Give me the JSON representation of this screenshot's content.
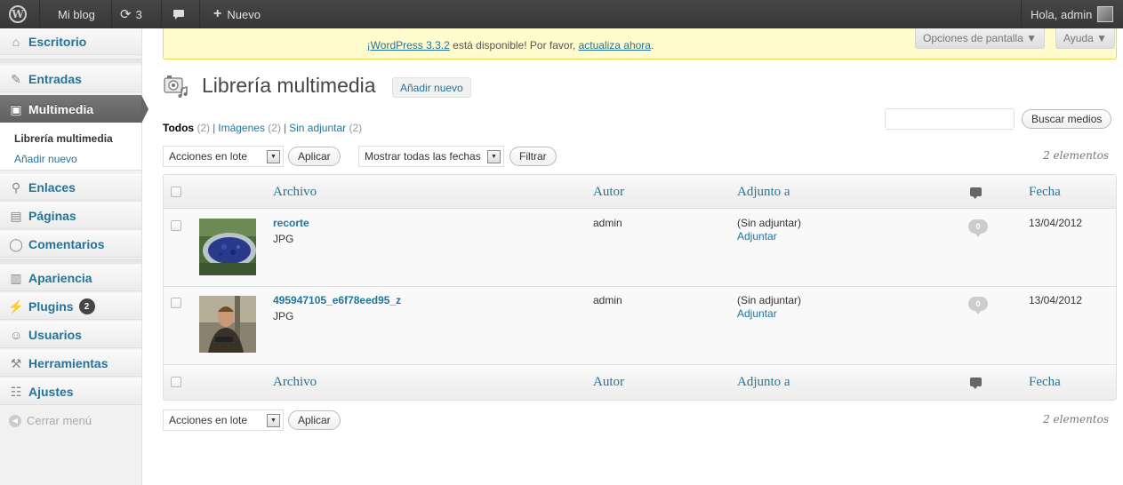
{
  "adminbar": {
    "site_name": "Mi blog",
    "updates_count": "3",
    "new_label": "Nuevo",
    "greeting": "Hola, admin"
  },
  "sidebar": {
    "items": [
      {
        "label": "Escritorio",
        "icon": "house-icon"
      },
      {
        "label": "Entradas",
        "icon": "pin-icon"
      },
      {
        "label": "Multimedia",
        "icon": "media-icon"
      },
      {
        "label": "Enlaces",
        "icon": "link-icon"
      },
      {
        "label": "Páginas",
        "icon": "pages-icon"
      },
      {
        "label": "Comentarios",
        "icon": "comments-icon"
      },
      {
        "label": "Apariencia",
        "icon": "appearance-icon"
      },
      {
        "label": "Plugins",
        "icon": "plugins-icon",
        "badge": "2"
      },
      {
        "label": "Usuarios",
        "icon": "users-icon"
      },
      {
        "label": "Herramientas",
        "icon": "tools-icon"
      },
      {
        "label": "Ajustes",
        "icon": "settings-icon"
      }
    ],
    "submenu": [
      "Librería multimedia",
      "Añadir nuevo"
    ],
    "collapse_label": "Cerrar menú"
  },
  "notice": {
    "link_version": "¡WordPress 3.3.2",
    "text": " está disponible! Por favor, ",
    "link_update": "actualiza ahora",
    "end": "."
  },
  "screen_options": "Opciones de pantalla ▼",
  "help": "Ayuda ▼",
  "page": {
    "title": "Librería multimedia",
    "add_new": "Añadir nuevo"
  },
  "filters": {
    "all_label": "Todos",
    "all_count": "(2)",
    "images_label": "Imágenes",
    "images_count": "(2)",
    "unattached_label": "Sin adjuntar",
    "unattached_count": "(2)"
  },
  "search_button": "Buscar medios",
  "bulk_actions": "Acciones en lote",
  "apply": "Aplicar",
  "date_filter": "Mostrar todas las fechas",
  "filter_button": "Filtrar",
  "items_count": "2 elementos",
  "columns": {
    "file": "Archivo",
    "author": "Autor",
    "attached": "Adjunto a",
    "date": "Fecha"
  },
  "rows": [
    {
      "title": "recorte",
      "ext": "JPG",
      "author": "admin",
      "attached": "(Sin adjuntar)",
      "attach_link": "Adjuntar",
      "comments": "0",
      "date": "13/04/2012"
    },
    {
      "title": "495947105_e6f78eed95_z",
      "ext": "JPG",
      "author": "admin",
      "attached": "(Sin adjuntar)",
      "attach_link": "Adjuntar",
      "comments": "0",
      "date": "13/04/2012"
    }
  ]
}
